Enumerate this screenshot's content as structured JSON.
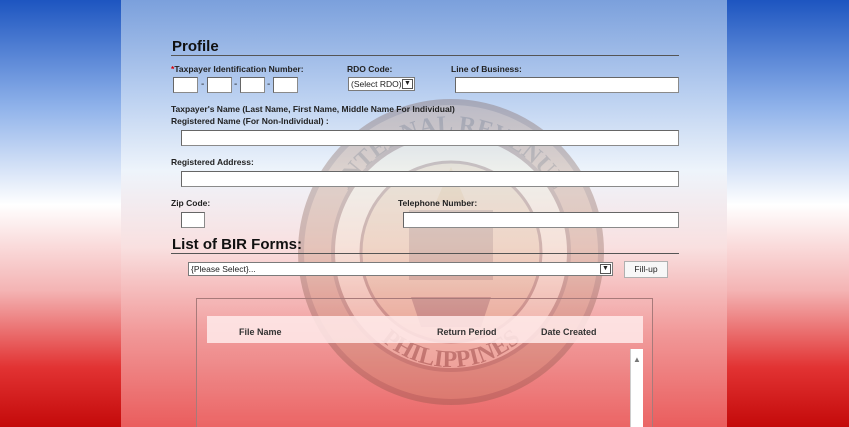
{
  "colors": {
    "accent_blue": "#1d55c0",
    "accent_red": "#c40a0a",
    "required": "#dd0000"
  },
  "profile": {
    "title": "Profile",
    "tin_required_marker": "*",
    "tin_label": "Taxpayer Identification Number:",
    "tin_separator": "-",
    "rdo_label": "RDO Code:",
    "rdo_selected": "(Select RDO)",
    "line_of_business_label": "Line of Business:",
    "taxpayer_name_label": "Taxpayer's Name (Last Name, First Name, Middle Name For Individual)",
    "registered_name_label": "Registered Name (For Non-Individual) :",
    "registered_address_label": "Registered Address:",
    "zip_label": "Zip Code:",
    "telephone_label": "Telephone Number:"
  },
  "forms": {
    "title": "List of BIR Forms:",
    "select_value": "{Please Select}...",
    "fillup_label": "Fill-up",
    "columns": [
      "File Name",
      "Return Period",
      "Date Created"
    ]
  },
  "background": {
    "seal_top_text": "INTERNAL REVENUE",
    "seal_bottom_text": "PHILIPPINES"
  }
}
